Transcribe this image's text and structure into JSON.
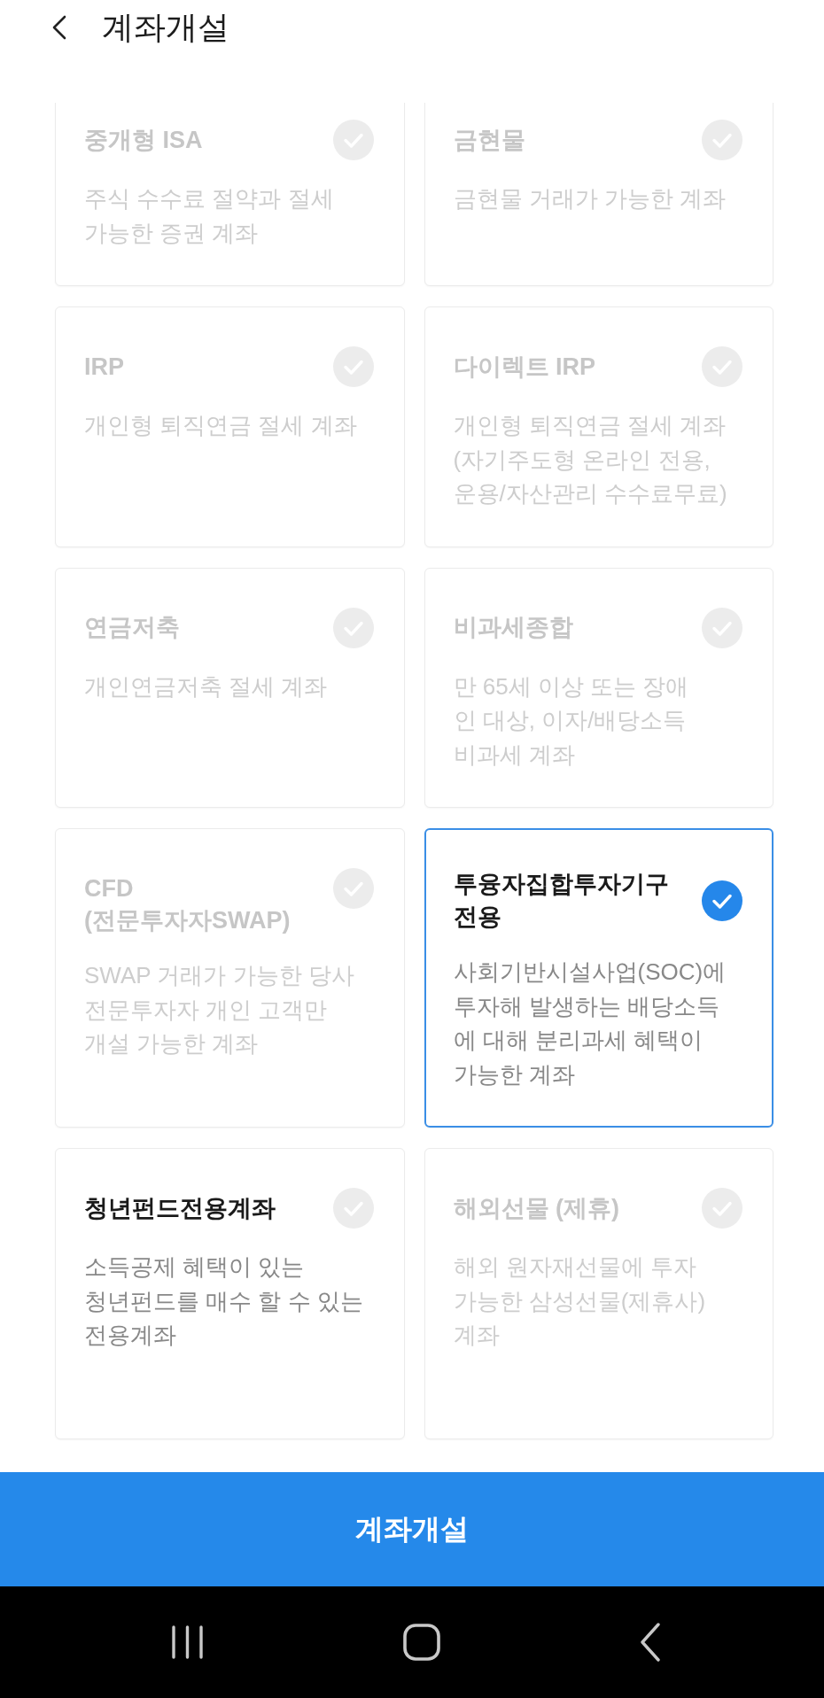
{
  "header": {
    "title": "계좌개설"
  },
  "accounts": [
    {
      "title": "중개형 ISA",
      "description": "주식 수수료 절약과 절세\n가능한 증권 계좌",
      "selected": false,
      "disabled": true
    },
    {
      "title": "금현물",
      "description": "금현물 거래가 가능한 계좌",
      "selected": false,
      "disabled": true
    },
    {
      "title": "IRP",
      "description": "개인형 퇴직연금 절세 계좌",
      "selected": false,
      "disabled": true
    },
    {
      "title": "다이렉트 IRP",
      "description": "개인형 퇴직연금 절세 계좌\n(자기주도형 온라인 전용,\n운용/자산관리 수수료무료)",
      "selected": false,
      "disabled": true
    },
    {
      "title": "연금저축",
      "description": "개인연금저축 절세 계좌",
      "selected": false,
      "disabled": true
    },
    {
      "title": "비과세종합",
      "description": "만 65세 이상 또는 장애\n인 대상, 이자/배당소득\n비과세 계좌",
      "selected": false,
      "disabled": true
    },
    {
      "title": "CFD",
      "subtitle": "(전문투자자SWAP)",
      "description": "SWAP 거래가 가능한 당사\n전문투자자 개인 고객만\n개설 가능한 계좌",
      "selected": false,
      "disabled": true
    },
    {
      "title": "투융자집합투자기구 전용",
      "description": "사회기반시설사업(SOC)에\n투자해 발생하는 배당소득\n에 대해 분리과세 혜택이\n가능한 계좌",
      "selected": true,
      "disabled": false
    },
    {
      "title": "청년펀드전용계좌",
      "description": "소득공제 혜택이 있는\n청년펀드를 매수 할 수 있는\n전용계좌",
      "selected": false,
      "disabled": false
    },
    {
      "title": "해외선물 (제휴)",
      "description": "해외 원자재선물에 투자\n가능한 삼성선물(제휴사)\n계좌",
      "selected": false,
      "disabled": true
    }
  ],
  "submit_button": {
    "label": "계좌개설"
  }
}
